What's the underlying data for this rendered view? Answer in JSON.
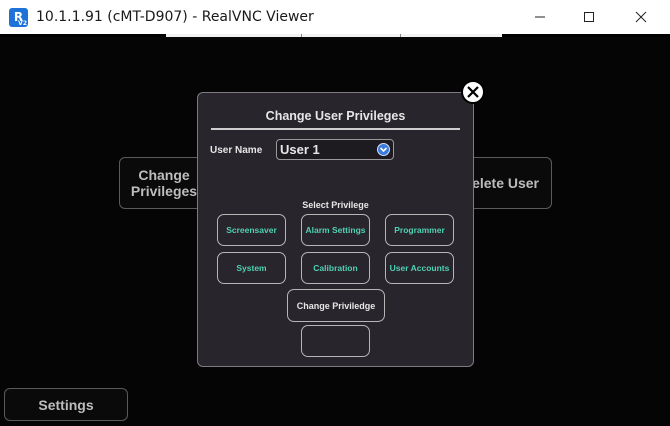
{
  "window": {
    "title": "10.1.1.91 (cMT-D907) - RealVNC Viewer",
    "app_icon": "realvnc-icon",
    "app_icon_letter": "R",
    "app_icon_sub": "V2"
  },
  "background": {
    "change_privileges": "Change Privileges",
    "delete_user": "Delete User",
    "settings": "Settings"
  },
  "dialog": {
    "title": "Change User Privileges",
    "user_name_label": "User Name",
    "user_name_value": "User 1",
    "select_privilege": "Select Privilege",
    "privileges": [
      "Screensaver",
      "Alarm Settings",
      "Programmer",
      "System",
      "Calibration",
      "User Accounts"
    ],
    "change_button": "Change Priviledge",
    "blank_button": ""
  },
  "colors": {
    "dialog_bg": "#29252c",
    "privilege_text": "#4fd1b3",
    "dropdown_accent": "#3d7bd9"
  }
}
